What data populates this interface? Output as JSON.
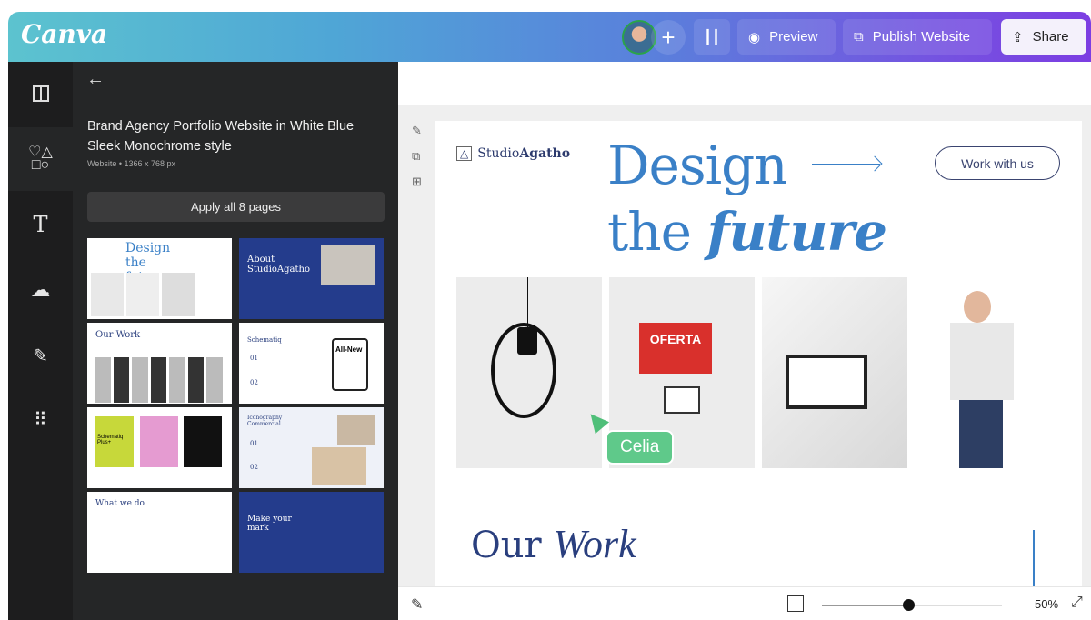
{
  "header": {
    "logo": "Canva",
    "preview": "Preview",
    "publish": "Publish Website",
    "share": "Share",
    "colors": {
      "gradient_start": "#5cc3cf",
      "gradient_end": "#7c3ee2"
    }
  },
  "rail": {
    "items": [
      {
        "icon": "design-layout-icon"
      },
      {
        "icon": "elements-icon"
      },
      {
        "icon": "text-icon"
      },
      {
        "icon": "upload-cloud-icon"
      },
      {
        "icon": "draw-icon"
      },
      {
        "icon": "apps-grid-icon"
      }
    ]
  },
  "panel": {
    "title": "Brand Agency Portfolio Website in White Blue Sleek Monochrome style",
    "subtitle": "Website • 1366 x 768 px",
    "apply": "Apply all 8 pages",
    "thumbs": [
      {
        "text": "Design the future"
      },
      {
        "text": "About StudioAgatho"
      },
      {
        "text": "Our Work"
      },
      {
        "text": "Schematiq",
        "extra": "All-New",
        "n1": "01",
        "n2": "02"
      },
      {
        "text": "Schematiq Plus+"
      },
      {
        "text": "Iconography Commercial",
        "n1": "01",
        "n2": "02"
      },
      {
        "text": "What we do"
      },
      {
        "text": "Make your mark"
      }
    ]
  },
  "page": {
    "brand_a": "Studio",
    "brand_b": "Agatho",
    "hero_line1": "Design",
    "hero_line2a": "the ",
    "hero_line2b": "future",
    "cta": "Work with us",
    "oferta": "OFERTA",
    "our": "Our ",
    "work": "Work",
    "collaborator": "Celia",
    "accent": "#3a80c7"
  },
  "footer": {
    "zoom": "50%",
    "zoom_value": 50
  }
}
